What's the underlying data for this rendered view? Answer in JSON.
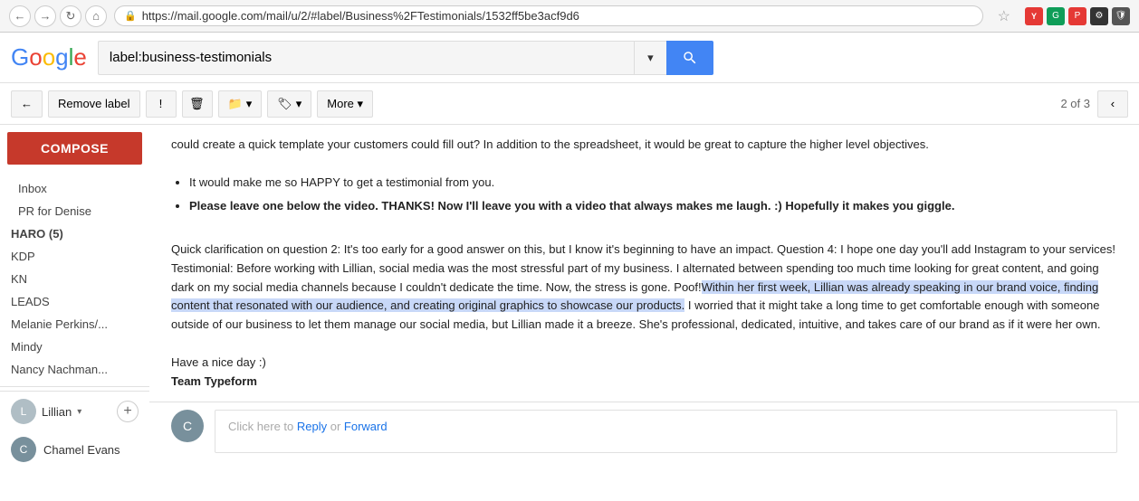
{
  "browser": {
    "url": "https://mail.google.com/mail/u/2/#label/Business%2FTestimonials/1532ff5be3acf9d6",
    "search_placeholder": "label:business-testimonials"
  },
  "toolbar": {
    "back_label": "←",
    "remove_label_label": "Remove label",
    "exclamation_label": "!",
    "trash_label": "🗑",
    "folder_label": "📁 ▾",
    "tag_label": "🏷 ▾",
    "more_label": "More ▾",
    "pagination": "2 of 3"
  },
  "sidebar": {
    "compose_label": "COMPOSE",
    "items": [
      {
        "label": "Inbox",
        "bold": false,
        "indented": false
      },
      {
        "label": "PR for Denise",
        "bold": false,
        "indented": true
      },
      {
        "label": "HARO (5)",
        "bold": true,
        "indented": false
      },
      {
        "label": "KDP",
        "bold": false,
        "indented": false
      },
      {
        "label": "KN",
        "bold": false,
        "indented": false
      },
      {
        "label": "LEADS",
        "bold": false,
        "indented": false
      },
      {
        "label": "Melanie Perkins/...",
        "bold": false,
        "indented": false
      },
      {
        "label": "Mindy",
        "bold": false,
        "indented": false
      },
      {
        "label": "Nancy Nachman...",
        "bold": false,
        "indented": false
      }
    ],
    "user_name": "Lillian",
    "sender_name": "Chamel Evans"
  },
  "email": {
    "intro": "could create a quick template your customers could fill out? In addition to the spreadsheet, it would be great to capture the higher level objectives.",
    "bullet1": "It would make me so HAPPY to get a testimonial from you.",
    "bullet2_bold": "Please leave one below the video. THANKS! Now I'll leave you with a video that always makes me laugh. :) Hopefully it makes you giggle.",
    "paragraph1": "Quick clarification on question 2: It's too early for a good answer on this, but I know it's beginning to have an impact. Question 4: I hope one day you'll add Instagram to your services! Testimonial: Before working with Lillian, social media was the most stressful part of my business. I alternated between spending too much time looking for great content, and going dark on my social media channels because I couldn't dedicate the time. Now, the stress is gone. Poof!",
    "highlight_text": "Within her first week, Lillian was already speaking in our brand voice, finding content that resonated with our audience, and creating original graphics to showcase our products.",
    "paragraph2": " I worried that it might take a long time to get comfortable enough with someone outside of our business to let them manage our social media, but Lillian made it a breeze. She's professional, dedicated, intuitive, and takes care of our brand as if it were her own.",
    "sign_off": "Have a nice day :)",
    "team": "Team Typeform",
    "reply_text": "Click here to ",
    "reply_link1": "Reply",
    "reply_or": " or ",
    "reply_link2": "Forward"
  },
  "colors": {
    "compose_bg": "#c6392b",
    "highlight_bg": "#c8d8f8",
    "search_btn": "#4285f4",
    "link": "#1a73e8"
  }
}
